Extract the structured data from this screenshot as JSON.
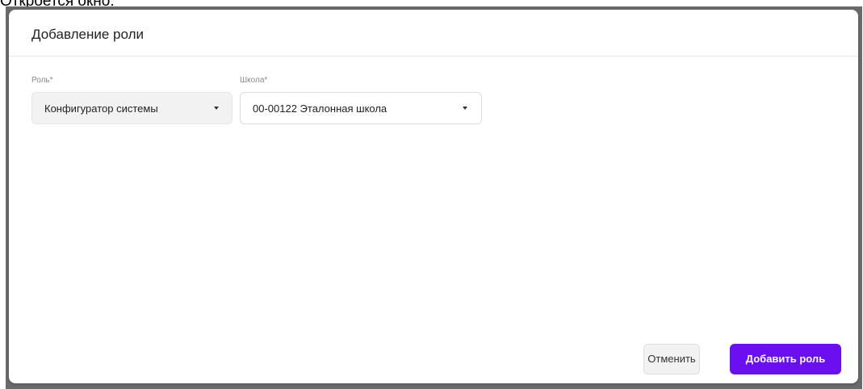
{
  "caption": "Откроется окно:",
  "dialog": {
    "title": "Добавление роли",
    "role_field": {
      "label": "Роль*",
      "value": "Конфигуратор системы"
    },
    "school_field": {
      "label": "Школа*",
      "value": "00-00122 Эталонная школа"
    },
    "buttons": {
      "cancel": "Отменить",
      "add_role": "Добавить роль"
    }
  },
  "colors": {
    "primary": "#6b0ff0",
    "backdrop": "#6a6a6a"
  }
}
